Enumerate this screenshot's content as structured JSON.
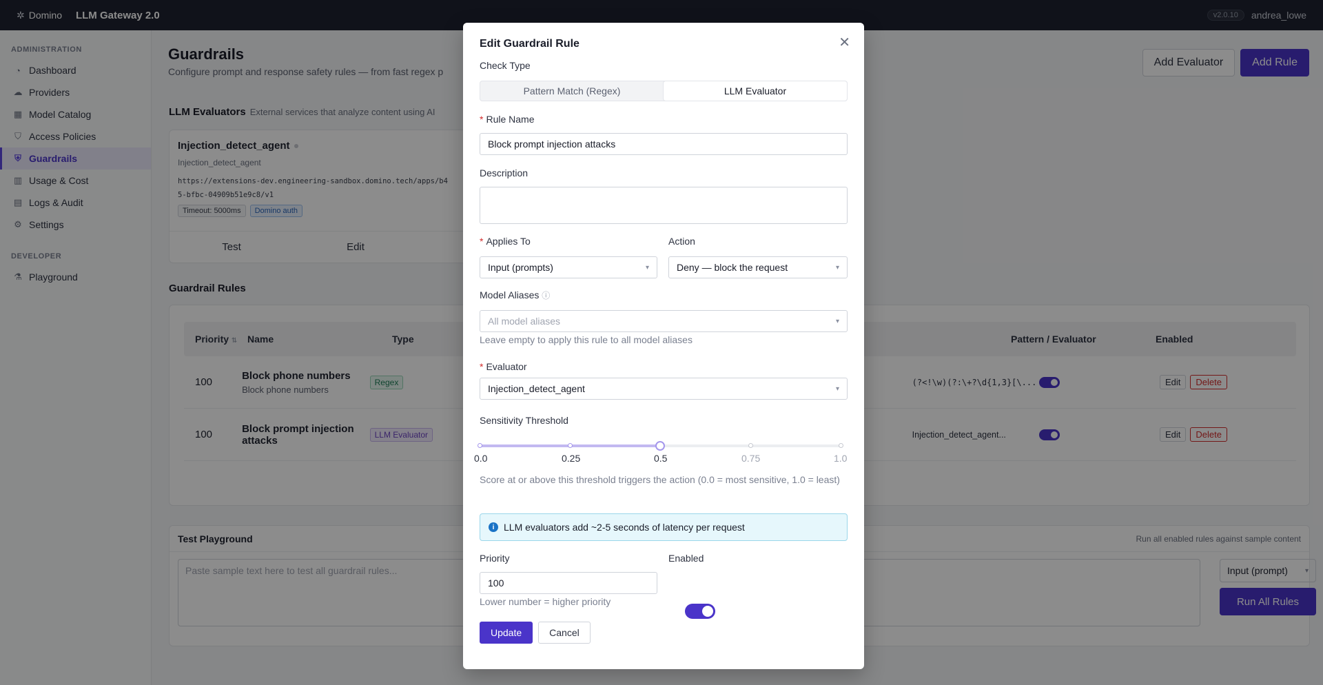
{
  "topbar": {
    "brand": "Domino",
    "product": "LLM Gateway 2.0",
    "version": "v2.0.10",
    "user": "andrea_lowe"
  },
  "sidebar": {
    "admin_section": "ADMINISTRATION",
    "items": [
      {
        "label": "Dashboard",
        "icon": "dashboard-icon"
      },
      {
        "label": "Providers",
        "icon": "cloud-icon"
      },
      {
        "label": "Model Catalog",
        "icon": "grid-icon"
      },
      {
        "label": "Access Policies",
        "icon": "shield-icon"
      },
      {
        "label": "Guardrails",
        "icon": "shield-check-icon",
        "active": true
      },
      {
        "label": "Usage & Cost",
        "icon": "chart-icon"
      },
      {
        "label": "Logs & Audit",
        "icon": "log-icon"
      },
      {
        "label": "Settings",
        "icon": "gear-icon"
      }
    ],
    "dev_section": "DEVELOPER",
    "dev_items": [
      {
        "label": "Playground",
        "icon": "flask-icon"
      }
    ]
  },
  "page": {
    "title": "Guardrails",
    "subtitle": "Configure prompt and response safety rules — from fast regex p",
    "add_evaluator": "Add Evaluator",
    "add_rule": "Add Rule"
  },
  "evaluators": {
    "title": "LLM Evaluators",
    "subtitle": "External services that analyze content using AI",
    "card": {
      "name": "Injection_detect_agent",
      "sub": "Injection_detect_agent",
      "url_line1": "https://extensions-dev.engineering-sandbox.domino.tech/apps/b4",
      "url_line2": "5-bfbc-04909b51e9c8/v1",
      "tag_timeout": "Timeout: 5000ms",
      "tag_auth": "Domino auth",
      "action_test": "Test",
      "action_edit": "Edit"
    }
  },
  "rules": {
    "title": "Guardrail Rules",
    "headers": {
      "priority": "Priority",
      "name": "Name",
      "type": "Type",
      "pattern": "Pattern / Evaluator",
      "enabled": "Enabled"
    },
    "rows": [
      {
        "priority": "100",
        "name": "Block phone numbers",
        "sub": "Block phone numbers",
        "type": "Regex",
        "pattern": "(?<!\\w)(?:\\+?\\d{1,3}[\\...",
        "edit": "Edit",
        "delete": "Delete"
      },
      {
        "priority": "100",
        "name": "Block prompt injection attacks",
        "sub": "",
        "type": "LLM Evaluator",
        "pattern": "Injection_detect_agent...",
        "edit": "Edit",
        "delete": "Delete"
      }
    ]
  },
  "playground": {
    "title": "Test Playground",
    "right_text": "Run all enabled rules against sample content",
    "placeholder": "Paste sample text here to test all guardrail rules...",
    "select": "Input (prompt)",
    "run": "Run All Rules"
  },
  "modal": {
    "title": "Edit Guardrail Rule",
    "check_type_label": "Check Type",
    "check_types": [
      "Pattern Match (Regex)",
      "LLM Evaluator"
    ],
    "rule_name_label": "Rule Name",
    "rule_name_value": "Block prompt injection attacks",
    "description_label": "Description",
    "applies_to_label": "Applies To",
    "applies_to_value": "Input (prompts)",
    "action_label": "Action",
    "action_value": "Deny — block the request",
    "aliases_label": "Model Aliases",
    "aliases_placeholder": "All model aliases",
    "aliases_help": "Leave empty to apply this rule to all model aliases",
    "evaluator_label": "Evaluator",
    "evaluator_value": "Injection_detect_agent",
    "threshold_label": "Sensitivity Threshold",
    "threshold_value": 0.5,
    "ticks": [
      "0.0",
      "0.25",
      "0.5",
      "0.75",
      "1.0"
    ],
    "threshold_help": "Score at or above this threshold triggers the action (0.0 = most sensitive, 1.0 = least)",
    "alert": "LLM evaluators add ~2-5 seconds of latency per request",
    "priority_label": "Priority",
    "priority_value": "100",
    "priority_help": "Lower number = higher priority",
    "enabled_label": "Enabled",
    "update": "Update",
    "cancel": "Cancel"
  }
}
